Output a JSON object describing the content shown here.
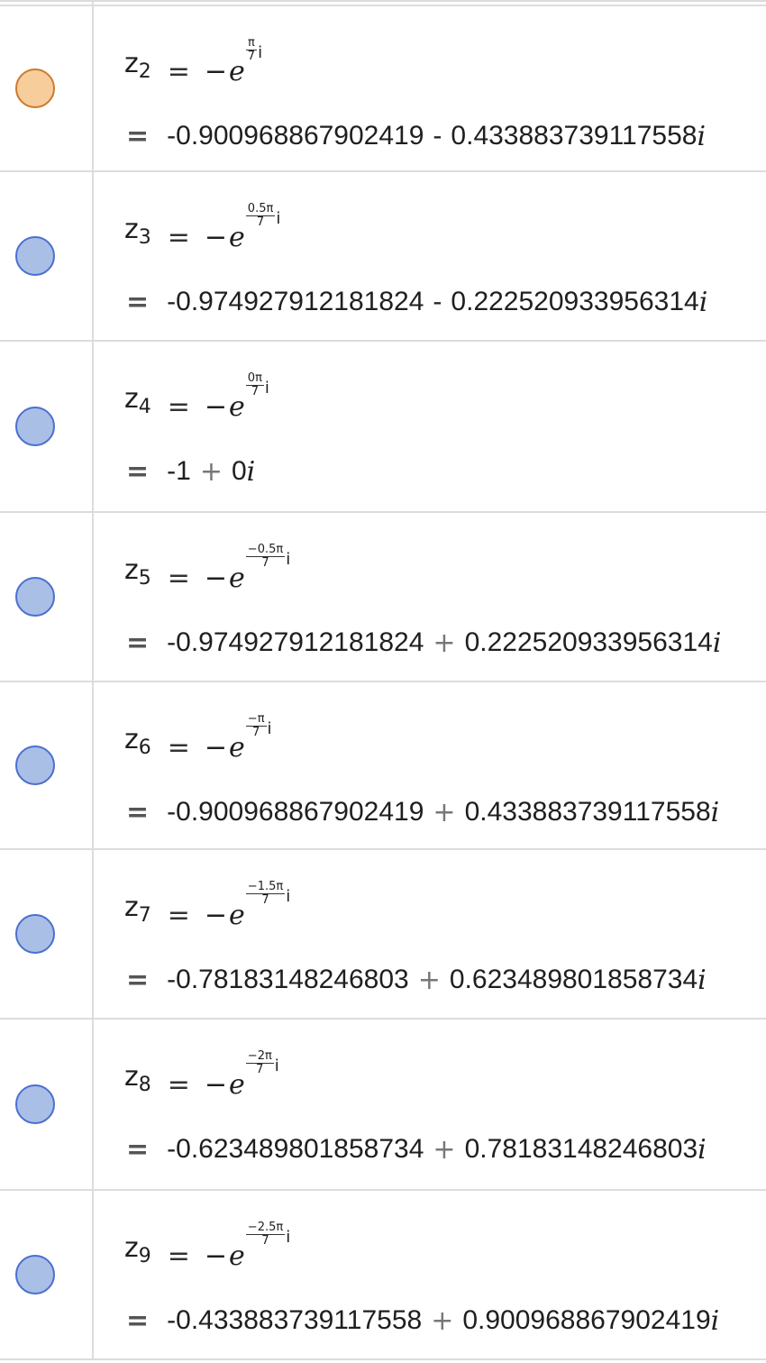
{
  "rows": [
    {
      "marble_color": "orange",
      "name": "z",
      "sub": "2",
      "equals": "=",
      "neg": "−",
      "e": "e",
      "exp_num": "π",
      "exp_den": "7",
      "imag": "i",
      "val_eq": "=",
      "real": "-0.900968867902419",
      "op": "-",
      "imag_val": "0.433883739117558",
      "imag_unit": "i"
    },
    {
      "marble_color": "blue",
      "name": "z",
      "sub": "3",
      "equals": "=",
      "neg": "−",
      "e": "e",
      "exp_num": "0.5π",
      "exp_den": "7",
      "imag": "i",
      "val_eq": "=",
      "real": "-0.974927912181824",
      "op": "-",
      "imag_val": "0.222520933956314",
      "imag_unit": "i"
    },
    {
      "marble_color": "blue",
      "name": "z",
      "sub": "4",
      "equals": "=",
      "neg": "−",
      "e": "e",
      "exp_num": "0π",
      "exp_den": "7",
      "imag": "i",
      "val_eq": "=",
      "real": "-1",
      "op": "+",
      "imag_val": "0",
      "imag_unit": "i"
    },
    {
      "marble_color": "blue",
      "name": "z",
      "sub": "5",
      "equals": "=",
      "neg": "−",
      "e": "e",
      "exp_num": "−0.5π",
      "exp_den": "7",
      "imag": "i",
      "val_eq": "=",
      "real": "-0.974927912181824",
      "op": "+",
      "imag_val": "0.222520933956314",
      "imag_unit": "i"
    },
    {
      "marble_color": "blue",
      "name": "z",
      "sub": "6",
      "equals": "=",
      "neg": "−",
      "e": "e",
      "exp_num": "−π",
      "exp_den": "7",
      "imag": "i",
      "val_eq": "=",
      "real": "-0.900968867902419",
      "op": "+",
      "imag_val": "0.433883739117558",
      "imag_unit": "i"
    },
    {
      "marble_color": "blue",
      "name": "z",
      "sub": "7",
      "equals": "=",
      "neg": "−",
      "e": "e",
      "exp_num": "−1.5π",
      "exp_den": "7",
      "imag": "i",
      "val_eq": "=",
      "real": "-0.78183148246803",
      "op": "+",
      "imag_val": "0.623489801858734",
      "imag_unit": "i"
    },
    {
      "marble_color": "blue",
      "name": "z",
      "sub": "8",
      "equals": "=",
      "neg": "−",
      "e": "e",
      "exp_num": "−2π",
      "exp_den": "7",
      "imag": "i",
      "val_eq": "=",
      "real": "-0.623489801858734",
      "op": "+",
      "imag_val": "0.78183148246803",
      "imag_unit": "i"
    },
    {
      "marble_color": "blue",
      "name": "z",
      "sub": "9",
      "equals": "=",
      "neg": "−",
      "e": "e",
      "exp_num": "−2.5π",
      "exp_den": "7",
      "imag": "i",
      "val_eq": "=",
      "real": "-0.433883739117558",
      "op": "+",
      "imag_val": "0.900968867902419",
      "imag_unit": "i"
    }
  ],
  "colors": {
    "marble_orange_fill": "#f8cd9c",
    "marble_orange_border": "#cc7a2c",
    "marble_blue_fill": "#aabfe6",
    "marble_blue_border": "#4a6fd0",
    "divider": "#dcdcdc"
  }
}
